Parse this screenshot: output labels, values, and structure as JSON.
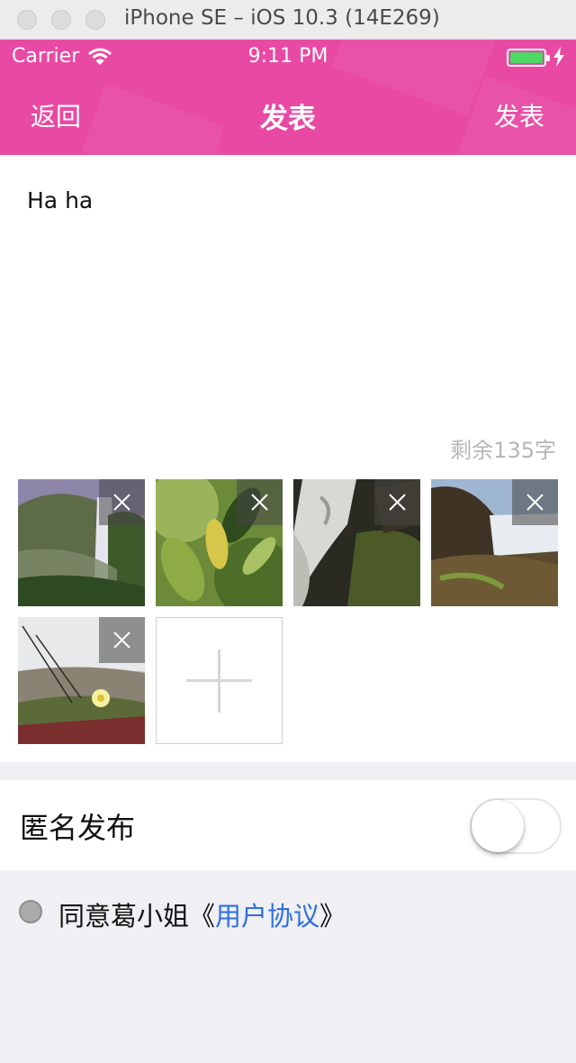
{
  "window": {
    "title": "iPhone SE – iOS 10.3 (14E269)"
  },
  "status_bar": {
    "carrier": "Carrier",
    "time": "9:11 PM",
    "battery_level": 1.0,
    "colors": {
      "battery_fill": "#4cd964"
    }
  },
  "nav": {
    "back_label": "返回",
    "title": "发表",
    "post_label": "发表",
    "colors": {
      "background": "#e84aa3",
      "text": "#ffffff"
    }
  },
  "post": {
    "text": "Ha ha",
    "remaining_label": "剩余135字"
  },
  "photos": [
    {
      "name": "waterfall-mist",
      "icon": "close-icon"
    },
    {
      "name": "green-leaves",
      "icon": "close-icon"
    },
    {
      "name": "waterfall-rocks",
      "icon": "close-icon"
    },
    {
      "name": "waterfall-river",
      "icon": "close-icon"
    },
    {
      "name": "wildflower-grass",
      "icon": "close-icon"
    }
  ],
  "add_photo": {
    "icon": "plus-icon"
  },
  "anonymous": {
    "label": "匿名发布",
    "enabled": false
  },
  "agreement": {
    "prefix": "同意葛小姐《",
    "link": "用户协议",
    "suffix": "》",
    "colors": {
      "link": "#2f6fdc"
    }
  }
}
